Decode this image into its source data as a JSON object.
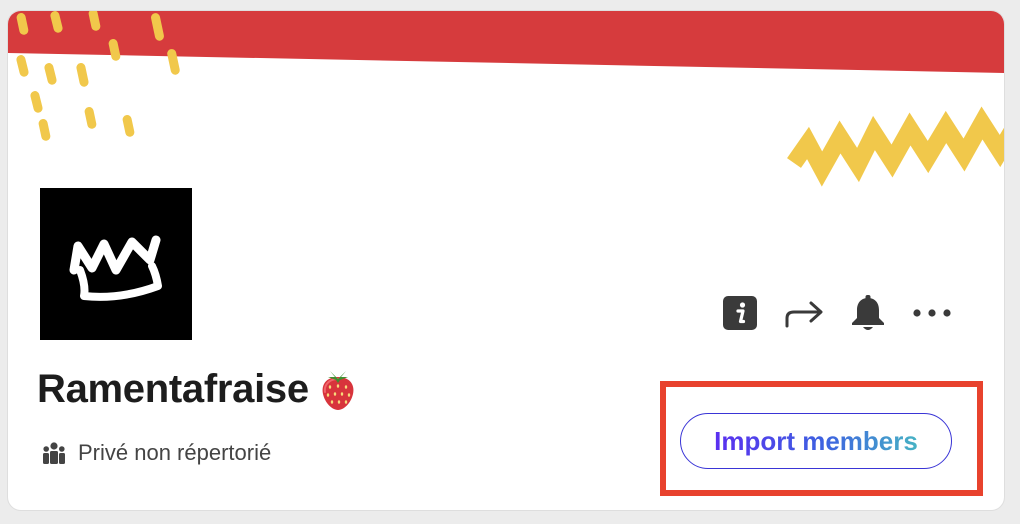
{
  "group": {
    "name": "Ramentafraise",
    "name_emoji": "strawberry-emoji",
    "privacy_label": "Privé non répertorié",
    "logo": "crown-logo"
  },
  "actions": {
    "info": "info-icon",
    "share": "share-arrow-icon",
    "notifications": "bell-icon",
    "more": "more-horizontal-icon"
  },
  "import_button": {
    "label": "Import members"
  },
  "colors": {
    "banner_red": "#d63b3d",
    "banner_yellow": "#f1c84b",
    "highlight": "#e8422d",
    "button_border": "#3a35d6",
    "button_gradient_start": "#5b2ff0",
    "button_gradient_end": "#47b3c4"
  }
}
